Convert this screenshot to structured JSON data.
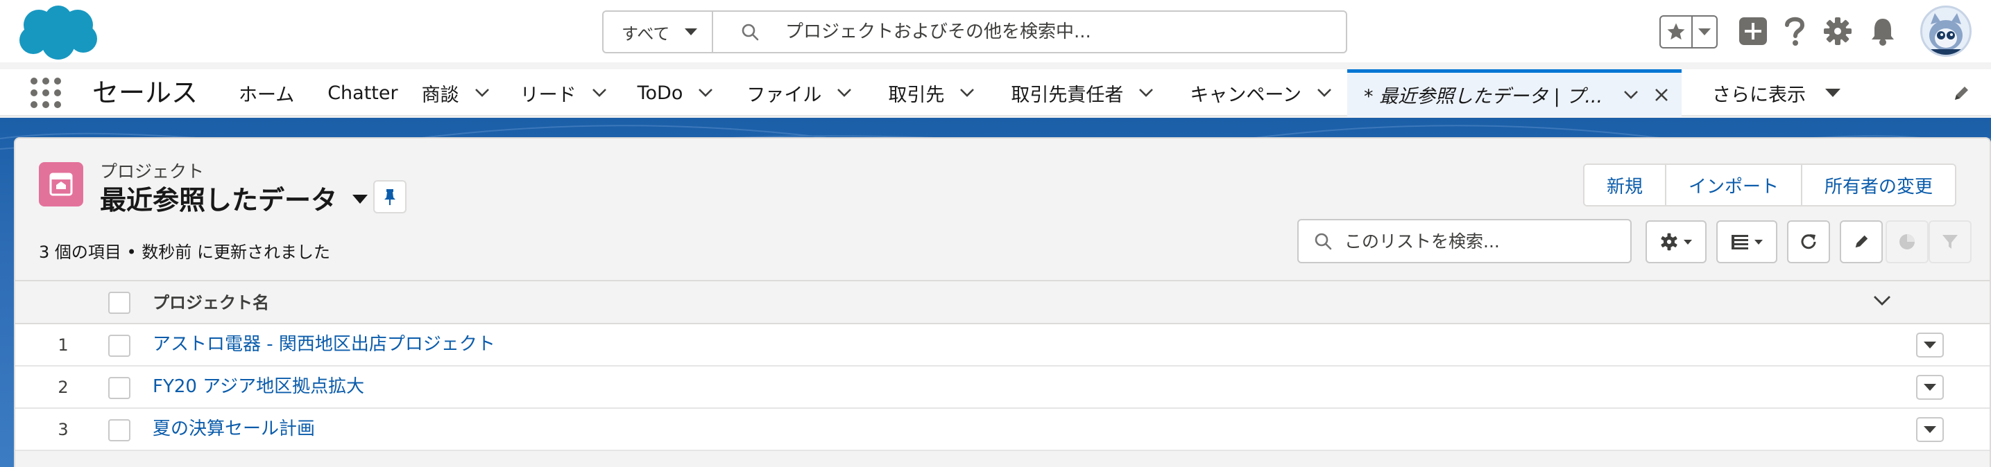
{
  "global_header": {
    "search_scope": "すべて",
    "search_placeholder": "プロジェクトおよびその他を検索中..."
  },
  "app_nav": {
    "app_name": "セールス",
    "items": [
      {
        "label": "ホーム",
        "has_menu": false
      },
      {
        "label": "Chatter",
        "has_menu": false
      },
      {
        "label": "商談",
        "has_menu": true
      },
      {
        "label": "リード",
        "has_menu": true
      },
      {
        "label": "ToDo",
        "has_menu": true
      },
      {
        "label": "ファイル",
        "has_menu": true
      },
      {
        "label": "取引先",
        "has_menu": true
      },
      {
        "label": "取引先責任者",
        "has_menu": true
      },
      {
        "label": "キャンペーン",
        "has_menu": true
      }
    ],
    "active_tab": {
      "label": "* 最近参照したデータ | プ..."
    },
    "more_label": "さらに表示"
  },
  "list_view": {
    "object_label": "プロジェクト",
    "title": "最近参照したデータ",
    "status": "3 個の項目 • 数秒前 に更新されました",
    "actions": [
      "新規",
      "インポート",
      "所有者の変更"
    ],
    "search_placeholder": "このリストを検索...",
    "column_header": "プロジェクト名",
    "rows": [
      {
        "num": "1",
        "name": "アストロ電器 - 関西地区出店プロジェクト"
      },
      {
        "num": "2",
        "name": "FY20 アジア地区拠点拡大"
      },
      {
        "num": "3",
        "name": "夏の決算セール計画"
      }
    ]
  },
  "colors": {
    "brand_blue": "#0176d3",
    "link_blue": "#0b5cab",
    "banner_blue": "#1b5fa8",
    "object_icon_pink": "#e3729b",
    "cloud_logo": "#1798c1"
  },
  "icons": [
    "salesforce-cloud-logo",
    "search-icon",
    "star-icon",
    "add-icon",
    "help-icon",
    "gear-icon",
    "bell-icon",
    "avatar",
    "app-launcher-icon",
    "pencil-icon",
    "pin-icon",
    "refresh-icon",
    "table-icon",
    "chart-icon",
    "filter-icon"
  ]
}
